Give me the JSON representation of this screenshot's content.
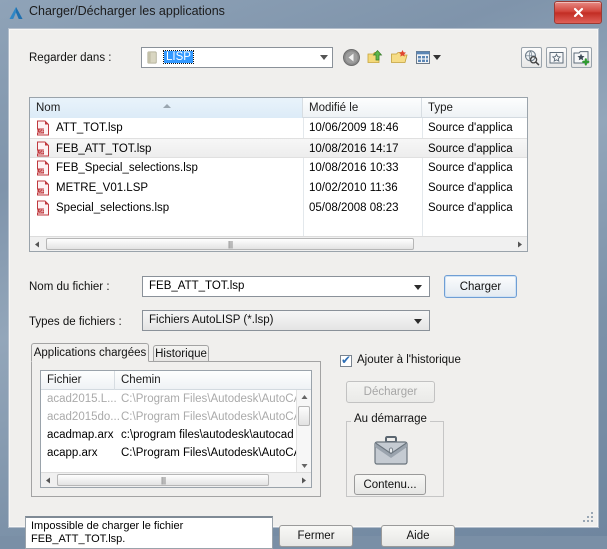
{
  "window": {
    "title": "Charger/Décharger les applications",
    "app_icon": "autocad-a-icon",
    "close_label": "x"
  },
  "lookin": {
    "label": "Regarder dans :",
    "value": "LISP",
    "folder_icon": "folder-icon",
    "dropdown_icon": "chevron-down-icon",
    "nav": {
      "back_icon": "back-arrow-icon",
      "up_icon": "up-one-level-icon",
      "new_folder_icon": "new-folder-icon",
      "views_icon": "views-icon",
      "views_arrow_icon": "chevron-down-icon"
    },
    "right_tools": {
      "search_web_icon": "search-the-web-icon",
      "favorites_icon": "favorites-icon",
      "add_favorites_icon": "add-to-favorites-icon"
    }
  },
  "filelist": {
    "columns": [
      "Nom",
      "Modifié le",
      "Type"
    ],
    "sort_indicator": "sort-ascending-icon",
    "rows": [
      {
        "icon": "lsp-file-icon",
        "name": "ATT_TOT.lsp",
        "modified": "10/06/2009 18:46",
        "type": "Source d'applica",
        "selected": false
      },
      {
        "icon": "lsp-file-icon",
        "name": "FEB_ATT_TOT.lsp",
        "modified": "10/08/2016 14:17",
        "type": "Source d'applica",
        "selected": true
      },
      {
        "icon": "lsp-file-icon",
        "name": "FEB_Special_selections.lsp",
        "modified": "10/08/2016 10:33",
        "type": "Source d'applica",
        "selected": false
      },
      {
        "icon": "lsp-file-icon",
        "name": "METRE_V01.LSP",
        "modified": "10/02/2010 11:36",
        "type": "Source d'applica",
        "selected": false
      },
      {
        "icon": "lsp-file-icon",
        "name": "Special_selections.lsp",
        "modified": "05/08/2008 08:23",
        "type": "Source d'applica",
        "selected": false
      }
    ],
    "scroll_left_icon": "scroll-left-icon",
    "scroll_right_icon": "scroll-right-icon"
  },
  "filename": {
    "label": "Nom du fichier :",
    "value": "FEB_ATT_TOT.lsp",
    "dropdown_icon": "chevron-down-icon"
  },
  "filetypes": {
    "label": "Types de fichiers :",
    "value": "Fichiers AutoLISP (*.lsp)",
    "dropdown_icon": "chevron-down-icon"
  },
  "load_button": {
    "label": "Charger"
  },
  "tabs": [
    {
      "label": "Applications chargées",
      "active": true
    },
    {
      "label": "Historique",
      "active": false
    }
  ],
  "applist": {
    "columns": [
      "Fichier",
      "Chemin"
    ],
    "rows": [
      {
        "file": "acad2015.L...",
        "path": "C:\\Program Files\\Autodesk\\AutoCA.",
        "dim": true
      },
      {
        "file": "acad2015do...",
        "path": "C:\\Program Files\\Autodesk\\AutoCA.",
        "dim": true
      },
      {
        "file": "acadmap.arx",
        "path": "c:\\program files\\autodesk\\autocad .",
        "dim": false
      },
      {
        "file": "acapp.arx",
        "path": "C:\\Program Files\\Autodesk\\AutoCA.",
        "dim": false
      }
    ],
    "scroll_up_icon": "scroll-up-icon",
    "scroll_down_icon": "scroll-down-icon",
    "scroll_left_icon": "scroll-left-icon",
    "scroll_right_icon": "scroll-right-icon"
  },
  "history_checkbox": {
    "label": "Ajouter à l'historique",
    "checked": true,
    "mark": "✔"
  },
  "unload_button": {
    "label": "Décharger",
    "enabled": false
  },
  "startup_group": {
    "label": "Au démarrage",
    "icon": "briefcase-icon",
    "button_label": "Contenu..."
  },
  "status": {
    "line1": "Impossible de charger le fichier",
    "line2": "FEB_ATT_TOT.lsp."
  },
  "footer": {
    "close_label": "Fermer",
    "help_label": "Aide"
  },
  "colors": {
    "accent_blue": "#3399ff",
    "close_red": "#c22d24",
    "dialog_bg": "#f0efed",
    "selection": "#ededed"
  }
}
